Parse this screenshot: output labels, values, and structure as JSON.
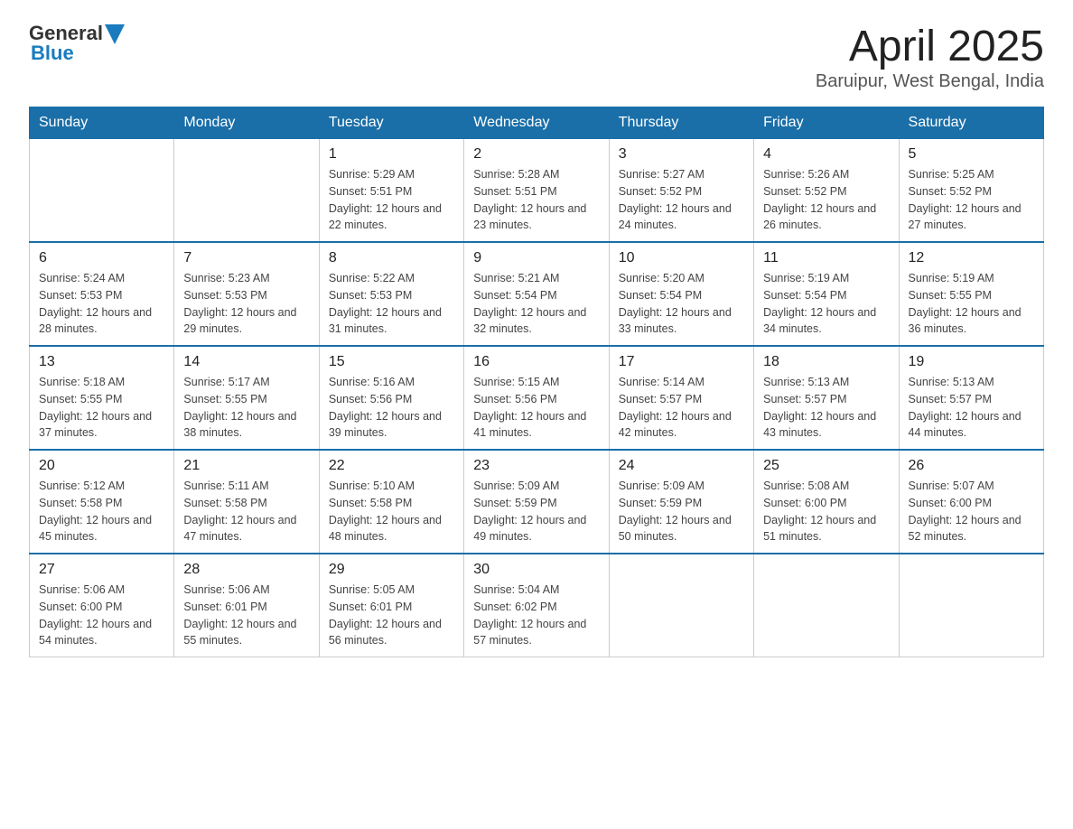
{
  "header": {
    "logo_general": "General",
    "logo_blue": "Blue",
    "title": "April 2025",
    "subtitle": "Baruipur, West Bengal, India"
  },
  "calendar": {
    "days_of_week": [
      "Sunday",
      "Monday",
      "Tuesday",
      "Wednesday",
      "Thursday",
      "Friday",
      "Saturday"
    ],
    "weeks": [
      [
        {
          "day": "",
          "sunrise": "",
          "sunset": "",
          "daylight": ""
        },
        {
          "day": "",
          "sunrise": "",
          "sunset": "",
          "daylight": ""
        },
        {
          "day": "1",
          "sunrise": "Sunrise: 5:29 AM",
          "sunset": "Sunset: 5:51 PM",
          "daylight": "Daylight: 12 hours and 22 minutes."
        },
        {
          "day": "2",
          "sunrise": "Sunrise: 5:28 AM",
          "sunset": "Sunset: 5:51 PM",
          "daylight": "Daylight: 12 hours and 23 minutes."
        },
        {
          "day": "3",
          "sunrise": "Sunrise: 5:27 AM",
          "sunset": "Sunset: 5:52 PM",
          "daylight": "Daylight: 12 hours and 24 minutes."
        },
        {
          "day": "4",
          "sunrise": "Sunrise: 5:26 AM",
          "sunset": "Sunset: 5:52 PM",
          "daylight": "Daylight: 12 hours and 26 minutes."
        },
        {
          "day": "5",
          "sunrise": "Sunrise: 5:25 AM",
          "sunset": "Sunset: 5:52 PM",
          "daylight": "Daylight: 12 hours and 27 minutes."
        }
      ],
      [
        {
          "day": "6",
          "sunrise": "Sunrise: 5:24 AM",
          "sunset": "Sunset: 5:53 PM",
          "daylight": "Daylight: 12 hours and 28 minutes."
        },
        {
          "day": "7",
          "sunrise": "Sunrise: 5:23 AM",
          "sunset": "Sunset: 5:53 PM",
          "daylight": "Daylight: 12 hours and 29 minutes."
        },
        {
          "day": "8",
          "sunrise": "Sunrise: 5:22 AM",
          "sunset": "Sunset: 5:53 PM",
          "daylight": "Daylight: 12 hours and 31 minutes."
        },
        {
          "day": "9",
          "sunrise": "Sunrise: 5:21 AM",
          "sunset": "Sunset: 5:54 PM",
          "daylight": "Daylight: 12 hours and 32 minutes."
        },
        {
          "day": "10",
          "sunrise": "Sunrise: 5:20 AM",
          "sunset": "Sunset: 5:54 PM",
          "daylight": "Daylight: 12 hours and 33 minutes."
        },
        {
          "day": "11",
          "sunrise": "Sunrise: 5:19 AM",
          "sunset": "Sunset: 5:54 PM",
          "daylight": "Daylight: 12 hours and 34 minutes."
        },
        {
          "day": "12",
          "sunrise": "Sunrise: 5:19 AM",
          "sunset": "Sunset: 5:55 PM",
          "daylight": "Daylight: 12 hours and 36 minutes."
        }
      ],
      [
        {
          "day": "13",
          "sunrise": "Sunrise: 5:18 AM",
          "sunset": "Sunset: 5:55 PM",
          "daylight": "Daylight: 12 hours and 37 minutes."
        },
        {
          "day": "14",
          "sunrise": "Sunrise: 5:17 AM",
          "sunset": "Sunset: 5:55 PM",
          "daylight": "Daylight: 12 hours and 38 minutes."
        },
        {
          "day": "15",
          "sunrise": "Sunrise: 5:16 AM",
          "sunset": "Sunset: 5:56 PM",
          "daylight": "Daylight: 12 hours and 39 minutes."
        },
        {
          "day": "16",
          "sunrise": "Sunrise: 5:15 AM",
          "sunset": "Sunset: 5:56 PM",
          "daylight": "Daylight: 12 hours and 41 minutes."
        },
        {
          "day": "17",
          "sunrise": "Sunrise: 5:14 AM",
          "sunset": "Sunset: 5:57 PM",
          "daylight": "Daylight: 12 hours and 42 minutes."
        },
        {
          "day": "18",
          "sunrise": "Sunrise: 5:13 AM",
          "sunset": "Sunset: 5:57 PM",
          "daylight": "Daylight: 12 hours and 43 minutes."
        },
        {
          "day": "19",
          "sunrise": "Sunrise: 5:13 AM",
          "sunset": "Sunset: 5:57 PM",
          "daylight": "Daylight: 12 hours and 44 minutes."
        }
      ],
      [
        {
          "day": "20",
          "sunrise": "Sunrise: 5:12 AM",
          "sunset": "Sunset: 5:58 PM",
          "daylight": "Daylight: 12 hours and 45 minutes."
        },
        {
          "day": "21",
          "sunrise": "Sunrise: 5:11 AM",
          "sunset": "Sunset: 5:58 PM",
          "daylight": "Daylight: 12 hours and 47 minutes."
        },
        {
          "day": "22",
          "sunrise": "Sunrise: 5:10 AM",
          "sunset": "Sunset: 5:58 PM",
          "daylight": "Daylight: 12 hours and 48 minutes."
        },
        {
          "day": "23",
          "sunrise": "Sunrise: 5:09 AM",
          "sunset": "Sunset: 5:59 PM",
          "daylight": "Daylight: 12 hours and 49 minutes."
        },
        {
          "day": "24",
          "sunrise": "Sunrise: 5:09 AM",
          "sunset": "Sunset: 5:59 PM",
          "daylight": "Daylight: 12 hours and 50 minutes."
        },
        {
          "day": "25",
          "sunrise": "Sunrise: 5:08 AM",
          "sunset": "Sunset: 6:00 PM",
          "daylight": "Daylight: 12 hours and 51 minutes."
        },
        {
          "day": "26",
          "sunrise": "Sunrise: 5:07 AM",
          "sunset": "Sunset: 6:00 PM",
          "daylight": "Daylight: 12 hours and 52 minutes."
        }
      ],
      [
        {
          "day": "27",
          "sunrise": "Sunrise: 5:06 AM",
          "sunset": "Sunset: 6:00 PM",
          "daylight": "Daylight: 12 hours and 54 minutes."
        },
        {
          "day": "28",
          "sunrise": "Sunrise: 5:06 AM",
          "sunset": "Sunset: 6:01 PM",
          "daylight": "Daylight: 12 hours and 55 minutes."
        },
        {
          "day": "29",
          "sunrise": "Sunrise: 5:05 AM",
          "sunset": "Sunset: 6:01 PM",
          "daylight": "Daylight: 12 hours and 56 minutes."
        },
        {
          "day": "30",
          "sunrise": "Sunrise: 5:04 AM",
          "sunset": "Sunset: 6:02 PM",
          "daylight": "Daylight: 12 hours and 57 minutes."
        },
        {
          "day": "",
          "sunrise": "",
          "sunset": "",
          "daylight": ""
        },
        {
          "day": "",
          "sunrise": "",
          "sunset": "",
          "daylight": ""
        },
        {
          "day": "",
          "sunrise": "",
          "sunset": "",
          "daylight": ""
        }
      ]
    ]
  }
}
